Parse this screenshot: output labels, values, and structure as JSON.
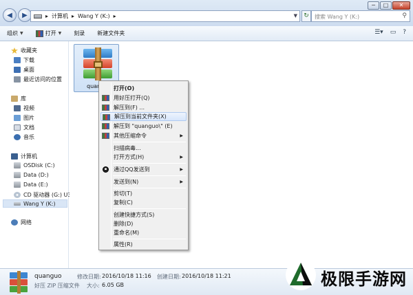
{
  "titlebar": {
    "min": "─",
    "max": "□",
    "close": "✕"
  },
  "nav": {
    "back_icon": "back-arrow-icon",
    "forward_icon": "forward-arrow-icon"
  },
  "address": {
    "sep1": "▸",
    "part1": "计算机",
    "sep2": "▸",
    "part2": "Wang Y (K:)",
    "sep3": "▸"
  },
  "search": {
    "placeholder": "搜索 Wang Y (K:)"
  },
  "toolbar": {
    "organize": "组织",
    "open": "打开",
    "burn": "刻录",
    "new_folder": "新建文件夹"
  },
  "sidebar": {
    "favorites": "收藏夹",
    "downloads": "下载",
    "desktop": "桌面",
    "recent": "最近访问的位置",
    "library": "库",
    "videos": "视频",
    "pictures": "图片",
    "documents": "文档",
    "music": "音乐",
    "computer": "计算机",
    "osdisk": "OSDisk (C:)",
    "data_d": "Data (D:)",
    "data_e": "Data (E:)",
    "cd": "CD 驱动器 (G:) U3",
    "wang": "Wang Y (K:)",
    "network": "网络"
  },
  "file": {
    "name": "quang"
  },
  "context_menu": {
    "open": "打开(O)",
    "open_haozip": "用好压打开(Q)",
    "extract_to": "解压到(F) ...",
    "extract_here": "解压到当前文件夹(X)",
    "extract_folder": "解压到 \"quanguo\\\" (E)",
    "more_commands": "其他压缩命令",
    "scan": "扫描病毒...",
    "open_with": "打开方式(H)",
    "qq_send": "通过QQ发送到",
    "send_to": "发送到(N)",
    "cut": "剪切(T)",
    "copy": "复制(C)",
    "shortcut": "创建快捷方式(S)",
    "delete": "删除(D)",
    "rename": "重命名(M)",
    "properties": "属性(R)",
    "arrow": "▶"
  },
  "details": {
    "name": "quanguo",
    "type": "好压 ZIP 压缩文件",
    "modified_label": "修改日期:",
    "modified": "2016/10/18 11:16",
    "created_label": "创建日期:",
    "created": "2016/10/18 11:21",
    "size_label": "大小:",
    "size": "6.05 GB"
  },
  "watermark": {
    "text": "极限手游网"
  }
}
